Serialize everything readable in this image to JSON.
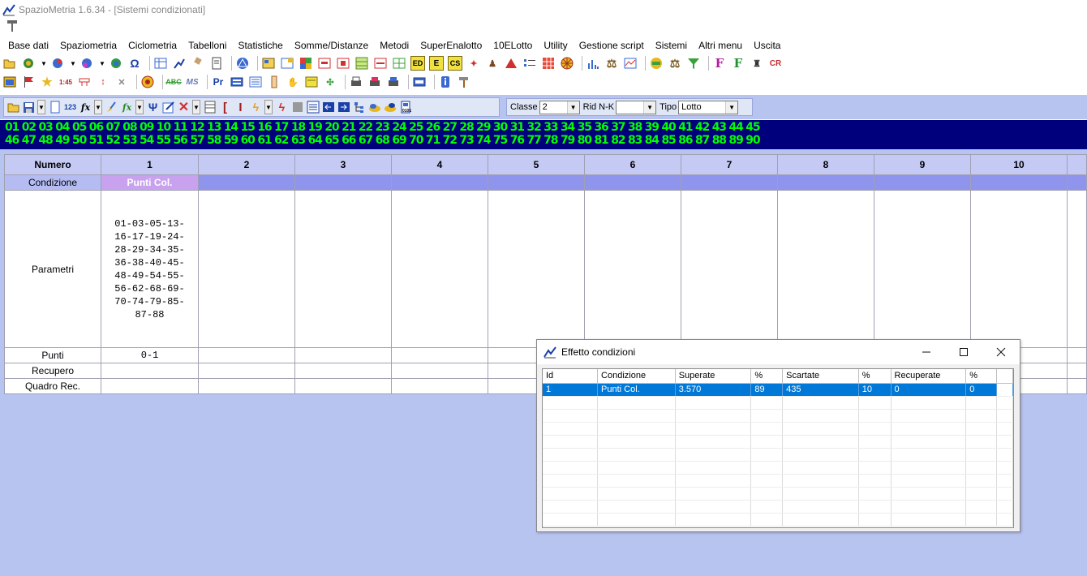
{
  "window": {
    "title": "SpazioMetria  1.6.34 - [Sistemi condizionati]"
  },
  "menu": [
    "Base dati",
    "Spaziometria",
    "Ciclometria",
    "Tabelloni",
    "Statistiche",
    "Somme/Distanze",
    "Metodi",
    "SuperEnalotto",
    "10ELotto",
    "Utility",
    "Gestione script",
    "Sistemi",
    "Altri menu",
    "Uscita"
  ],
  "toolbar_labels": {
    "lotto_1_45": "1:45",
    "ms": "MS",
    "pr": "Pr",
    "ed": "ED",
    "e": "E",
    "cs": "CS",
    "cr": "CR",
    "f": "F",
    "omega": "Ω",
    "one_two_three": "123",
    "fx": "fx"
  },
  "selectors": {
    "classe": {
      "label": "Classe",
      "value": "2"
    },
    "rid": {
      "label": "Rid N-K",
      "value": ""
    },
    "tipo": {
      "label": "Tipo",
      "value": "Lotto"
    }
  },
  "number_band": {
    "row1": "01 02 03 04 05 06 07 08 09 10 11 12 13 14 15 16 17 18 19 20 21 22 23 24 25 26 27 28 29 30 31 32 33 34 35 36 37 38 39 40 41 42 43 44 45",
    "row2": "46 47 48 49 50 51 52 53 54 55 56 57 58 59 60 61 62 63 64 65 66 67 68 69 70 71 72 73 74 75 76 77 78 79 80 81 82 83 84 85 86 87 88 89 90"
  },
  "grid": {
    "row_headers": {
      "numero": "Numero",
      "condizione": "Condizione",
      "parametri": "Parametri",
      "punti": "Punti",
      "recupero": "Recupero",
      "quadro": "Quadro Rec."
    },
    "columns": [
      "1",
      "2",
      "3",
      "4",
      "5",
      "6",
      "7",
      "8",
      "9",
      "10"
    ],
    "col1": {
      "condizione": "Punti Col.",
      "parametri": [
        "01-03-05-13-",
        "16-17-19-24-",
        "28-29-34-35-",
        "36-38-40-45-",
        "48-49-54-55-",
        "56-62-68-69-",
        "70-74-79-85-",
        "87-88"
      ],
      "punti": "0-1"
    }
  },
  "dialog": {
    "title": "Effetto condizioni",
    "headers": [
      "Id",
      "Condizione",
      "Superate",
      "%",
      "Scartate",
      "%",
      "Recuperate",
      "%"
    ],
    "rows": [
      [
        "1",
        "Punti Col.",
        "3.570",
        "89",
        "435",
        "10",
        "0",
        "0"
      ]
    ]
  },
  "colors": {
    "grid_bg": "#b8c4f0",
    "number_band_bg": "#00007c",
    "number_text": "#00ff00",
    "selection": "#0078d7",
    "param_cell": "#ffc8f8"
  }
}
